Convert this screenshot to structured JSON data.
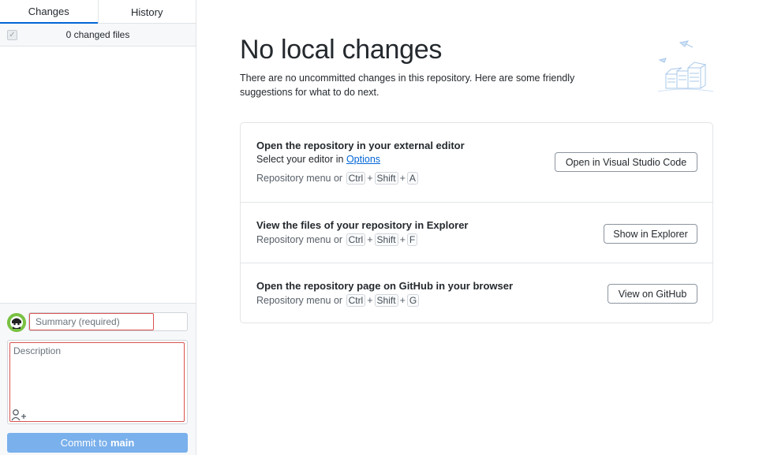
{
  "sidebar": {
    "tabs": [
      {
        "label": "Changes",
        "active": true
      },
      {
        "label": "History",
        "active": false
      }
    ],
    "changed_files": "0 changed files"
  },
  "commit": {
    "summary_placeholder": "Summary (required)",
    "description_placeholder": "Description",
    "button_label": "Commit to",
    "branch": "main"
  },
  "main": {
    "title": "No local changes",
    "subtitle": "There are no uncommitted changes in this repository. Here are some friendly suggestions for what to do next.",
    "cards": [
      {
        "title": "Open the repository in your external editor",
        "text_prefix": "Select your editor in ",
        "link": "Options",
        "shortcut_prefix": "Repository menu or",
        "keys": [
          "Ctrl",
          "Shift",
          "A"
        ],
        "button": "Open in Visual Studio Code"
      },
      {
        "title": "View the files of your repository in Explorer",
        "shortcut_prefix": "Repository menu or",
        "keys": [
          "Ctrl",
          "Shift",
          "F"
        ],
        "button": "Show in Explorer"
      },
      {
        "title": "Open the repository page on GitHub in your browser",
        "shortcut_prefix": "Repository menu or",
        "keys": [
          "Ctrl",
          "Shift",
          "G"
        ],
        "button": "View on GitHub"
      }
    ],
    "key_separator": "+"
  },
  "icons": {
    "avatar": "user-avatar-icon",
    "coauthor": "add-coauthor-icon",
    "illustration": "empty-repo-illustration-icon"
  },
  "colors": {
    "accent": "#0366d6",
    "commit_button": "#7ab0ec",
    "annotation_outline": "#d9534f"
  }
}
